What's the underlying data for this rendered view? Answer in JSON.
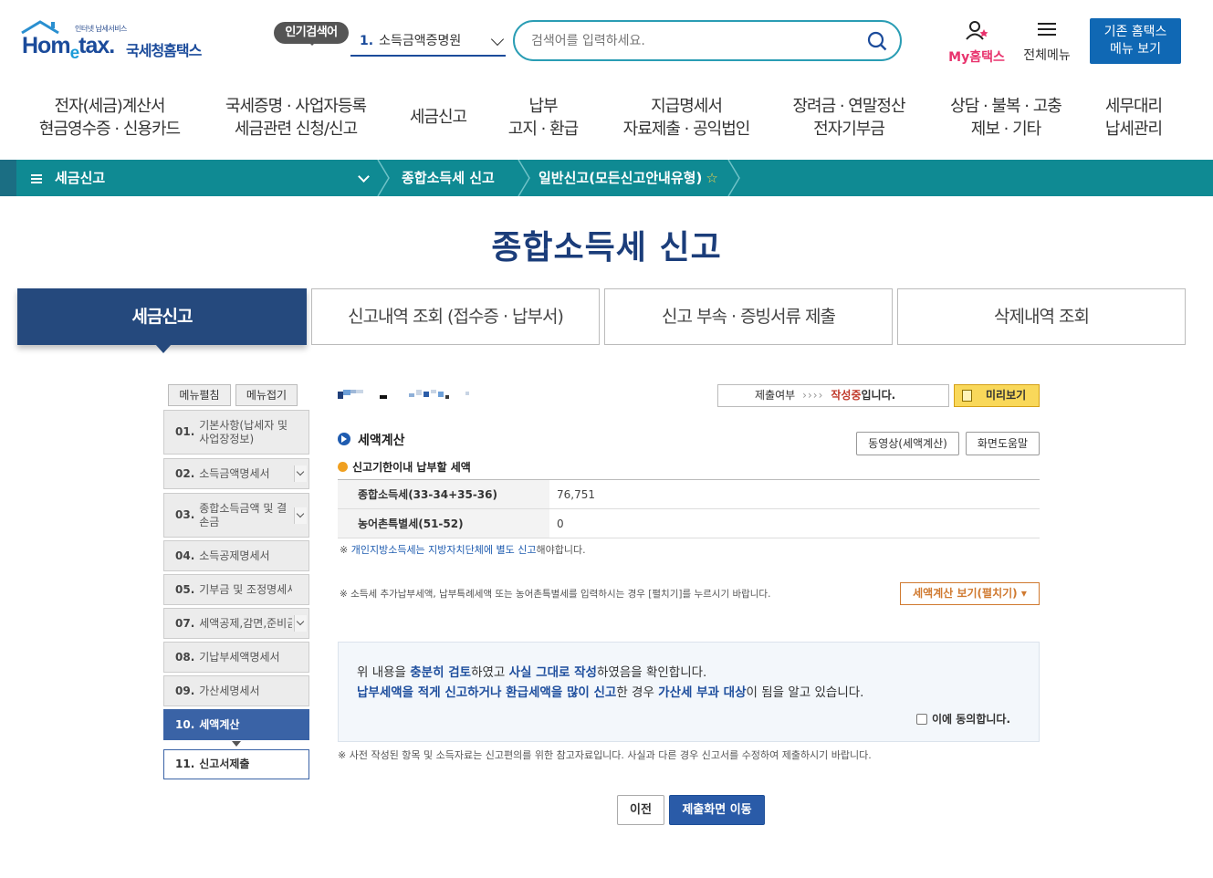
{
  "header": {
    "logo_small": "인터넷 납세서비스",
    "logo_brand_pre": "Hom",
    "logo_brand_e": "e",
    "logo_brand_post": "tax.",
    "logo_korean": "국세청홈택스",
    "popular_badge": "인기검색어",
    "popular_num": "1.",
    "popular_term": "소득금액증명원",
    "search_placeholder": "검색어를 입력하세요.",
    "my_hometax": "My홈택스",
    "all_menu": "전체메뉴",
    "old_menu_line1": "기존 홈택스",
    "old_menu_line2": "메뉴 보기"
  },
  "gnb": [
    {
      "line1": "전자(세금)계산서",
      "line2": "현금영수증 · 신용카드"
    },
    {
      "line1": "국세증명 · 사업자등록",
      "line2": "세금관련 신청/신고"
    },
    {
      "line1": "세금신고",
      "line2": ""
    },
    {
      "line1": "납부",
      "line2": "고지 · 환급"
    },
    {
      "line1": "지급명세서",
      "line2": "자료제출 · 공익법인"
    },
    {
      "line1": "장려금 · 연말정산",
      "line2": "전자기부금"
    },
    {
      "line1": "상담 · 불복 · 고충",
      "line2": "제보 · 기타"
    },
    {
      "line1": "세무대리",
      "line2": "납세관리"
    }
  ],
  "location": {
    "menu": "세금신고",
    "crumb1": "종합소득세 신고",
    "crumb2": "일반신고(모든신고안내유형)",
    "star": "☆"
  },
  "page_title": "종합소득세 신고",
  "tabs": [
    {
      "label": "세금신고"
    },
    {
      "label": "신고내역 조회 (접수증 · 납부서)"
    },
    {
      "label": "신고 부속 · 증빙서류 제출"
    },
    {
      "label": "삭제내역 조회"
    }
  ],
  "left_menu": {
    "expand": "메뉴펼침",
    "collapse": "메뉴접기",
    "items": [
      {
        "num": "01.",
        "label": "기본사항(납세자 및 사업장정보)"
      },
      {
        "num": "02.",
        "label": "소득금액명세서"
      },
      {
        "num": "03.",
        "label": "종합소득금액 및 결손금"
      },
      {
        "num": "04.",
        "label": "소득공제명세서"
      },
      {
        "num": "05.",
        "label": "기부금 및 조정명세서"
      },
      {
        "num": "07.",
        "label": "세액공제,감면,준비금"
      },
      {
        "num": "08.",
        "label": "기납부세액명세서"
      },
      {
        "num": "09.",
        "label": "가산세명세서"
      },
      {
        "num": "10.",
        "label": "세액계산"
      },
      {
        "num": "11.",
        "label": "신고서제출"
      }
    ]
  },
  "status": {
    "label": "제출여부",
    "arrows": "››››",
    "state": "작성중",
    "suffix": "입니다.",
    "preview": "미리보기"
  },
  "section": {
    "title": "세액계산",
    "video_btn": "동영상(세액계산)",
    "help_btn": "화면도움말",
    "sub_title": "신고기한이내 납부할 세액",
    "rows": [
      {
        "label": "종합소득세(33-34+35-36)",
        "value": "76,751"
      },
      {
        "label": "농어촌특별세(51-52)",
        "value": "0"
      }
    ],
    "note1_pre": "※ ",
    "note1_hl": "개인지방소득세는 지방자치단체에 별도 신고",
    "note1_post": "해야합니다.",
    "note2": "※ 소득세 추가납부세액, 납부특례세액 또는 농어촌특별세를 입력하시는 경우 [펼치기]를 누르시기 바랍니다.",
    "calc_btn": "세액계산 보기(펼치기) ▾"
  },
  "agree": {
    "line1_a": "위 내용을 ",
    "line1_b": "충분히 검토",
    "line1_c": "하였고 ",
    "line1_d": "사실 그대로 작성",
    "line1_e": "하였음을 확인합니다.",
    "line2_a": "납부세액을 적게 신고하거나 환급세액을 많이 신고",
    "line2_b": "한 경우 ",
    "line2_c": "가산세 부과 대상",
    "line2_d": "이 됨을 알고 있습니다.",
    "check": "이에 동의합니다."
  },
  "footnote": "※ 사전 작성된 항목 및 소득자료는 신고편의를 위한 참고자료입니다. 사실과 다른 경우 신고서를 수정하여 제출하시기 바랍니다.",
  "buttons": {
    "prev": "이전",
    "go": "제출화면 이동"
  }
}
